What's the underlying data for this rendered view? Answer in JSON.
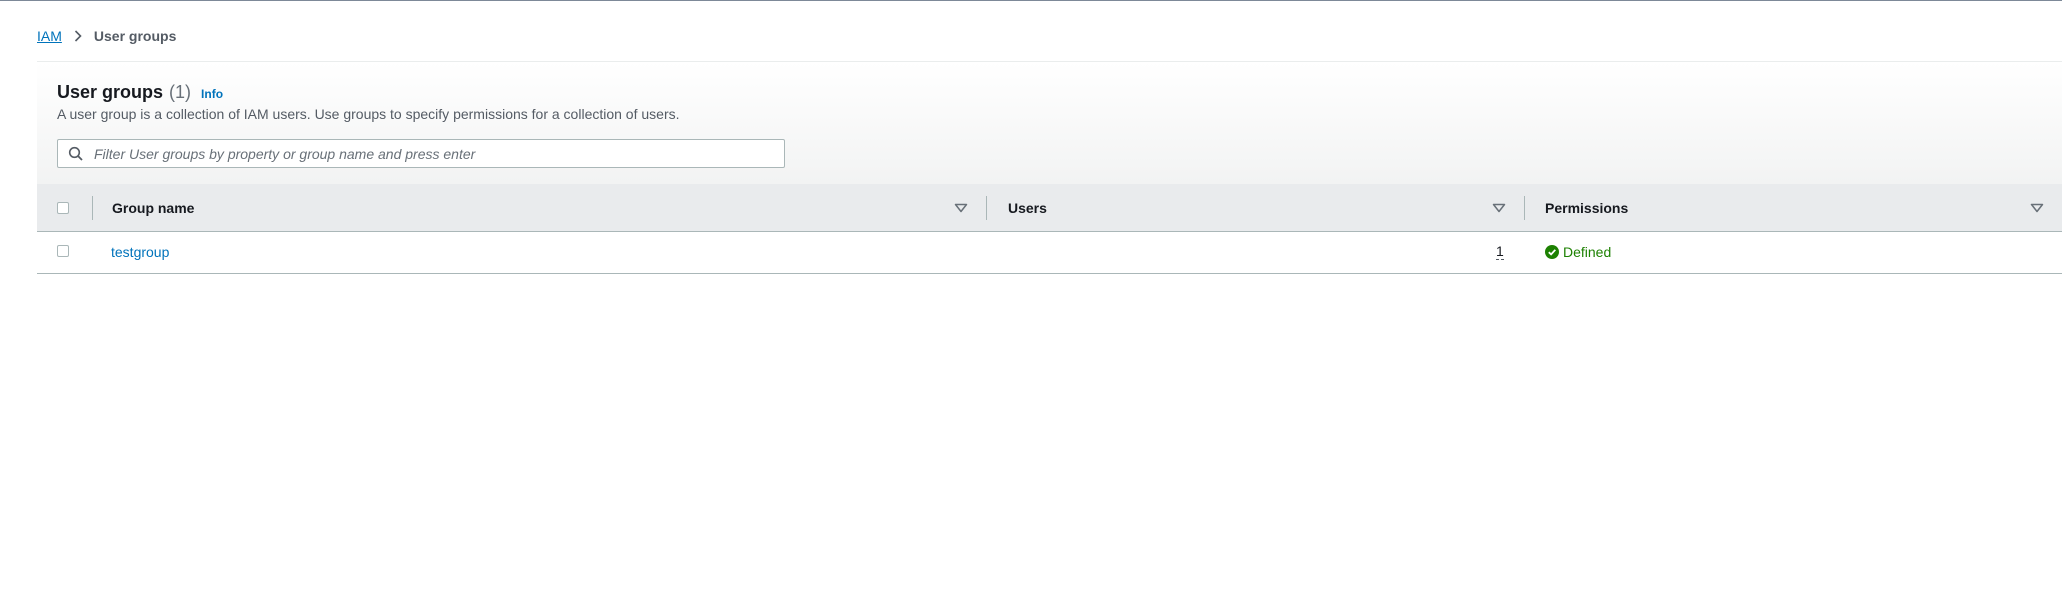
{
  "breadcrumb": {
    "root": "IAM",
    "current": "User groups"
  },
  "panel": {
    "title": "User groups",
    "count": "(1)",
    "info": "Info",
    "description": "A user group is a collection of IAM users. Use groups to specify permissions for a collection of users."
  },
  "search": {
    "placeholder": "Filter User groups by property or group name and press enter",
    "value": ""
  },
  "table": {
    "columns": [
      {
        "label": "Group name"
      },
      {
        "label": "Users"
      },
      {
        "label": "Permissions"
      }
    ],
    "rows": [
      {
        "group_name": "testgroup",
        "users": "1",
        "permissions": "Defined"
      }
    ]
  },
  "icons": {
    "breadcrumb_separator": "chevron-right-icon",
    "search": "search-icon",
    "sort": "sort-caret-down-icon",
    "status": "check-circle-icon"
  },
  "colors": {
    "link": "#0073bb",
    "success": "#1d8102",
    "header_bg": "#e9ebed"
  }
}
